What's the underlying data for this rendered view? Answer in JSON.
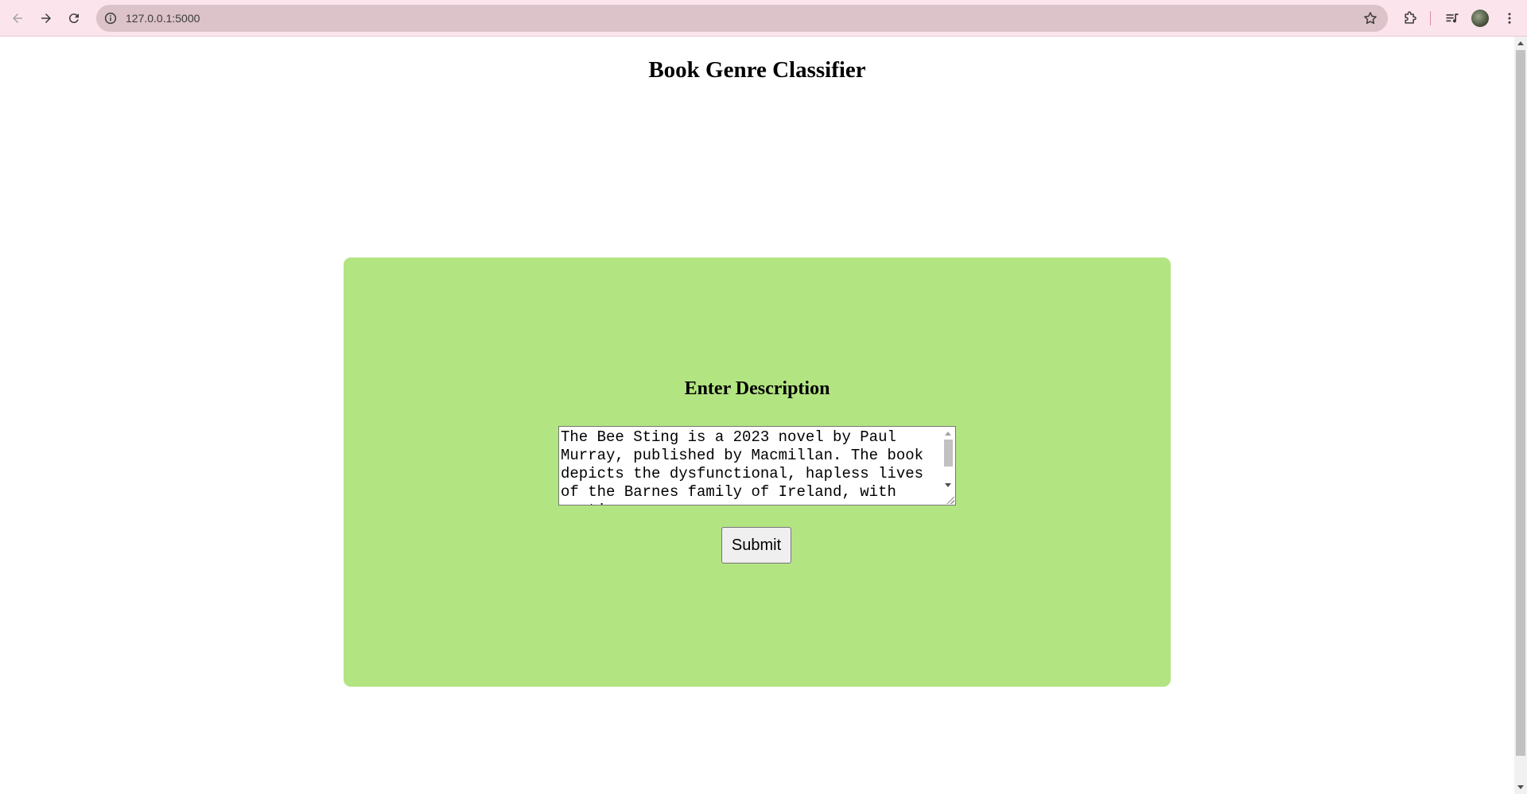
{
  "browser": {
    "url": "127.0.0.1:5000",
    "icons": {
      "back": "back-arrow-icon",
      "forward": "forward-arrow-icon",
      "reload": "reload-icon",
      "site_info": "info-icon",
      "bookmark": "star-icon",
      "extensions": "puzzle-icon",
      "media": "media-queue-icon",
      "profile": "avatar",
      "menu": "kebab-menu-icon"
    },
    "colors": {
      "toolbar": "#fce4ec",
      "omnibox": "#dcc2c9"
    }
  },
  "page": {
    "title": "Book Genre Classifier",
    "form": {
      "heading": "Enter Description",
      "description_value": "The Bee Sting is a 2023 novel by Paul Murray, published by Macmillan. The book depicts the dysfunctional, hapless lives of the Barnes family of Ireland, with portions",
      "submit_label": "Submit"
    },
    "colors": {
      "card_background": "#b3e482",
      "page_background": "#ffffff"
    }
  }
}
